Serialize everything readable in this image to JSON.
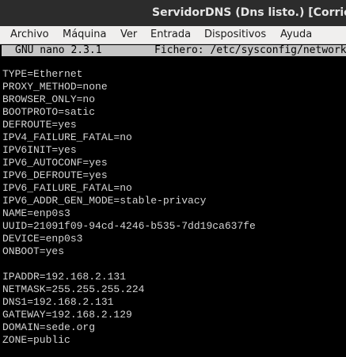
{
  "window": {
    "title": "ServidorDNS (Dns listo.) [Corriendo"
  },
  "menubar": {
    "items": [
      "Archivo",
      "Máquina",
      "Ver",
      "Entrada",
      "Dispositivos",
      "Ayuda"
    ]
  },
  "nano": {
    "version": "GNU nano 2.3.1",
    "file_label": "Fichero: /etc/sysconfig/network"
  },
  "file_lines": [
    "TYPE=Ethernet",
    "PROXY_METHOD=none",
    "BROWSER_ONLY=no",
    "BOOTPROTO=satic",
    "DEFROUTE=yes",
    "IPV4_FAILURE_FATAL=no",
    "IPV6INIT=yes",
    "IPV6_AUTOCONF=yes",
    "IPV6_DEFROUTE=yes",
    "IPV6_FAILURE_FATAL=no",
    "IPV6_ADDR_GEN_MODE=stable-privacy",
    "NAME=enp0s3",
    "UUID=21091f09-94cd-4246-b535-7dd19ca637fe",
    "DEVICE=enp0s3",
    "ONBOOT=yes",
    "",
    "IPADDR=192.168.2.131",
    "NETMASK=255.255.255.224",
    "DNS1=192.168.2.131",
    "GATEWAY=192.168.2.129",
    "DOMAIN=sede.org",
    "ZONE=public"
  ]
}
